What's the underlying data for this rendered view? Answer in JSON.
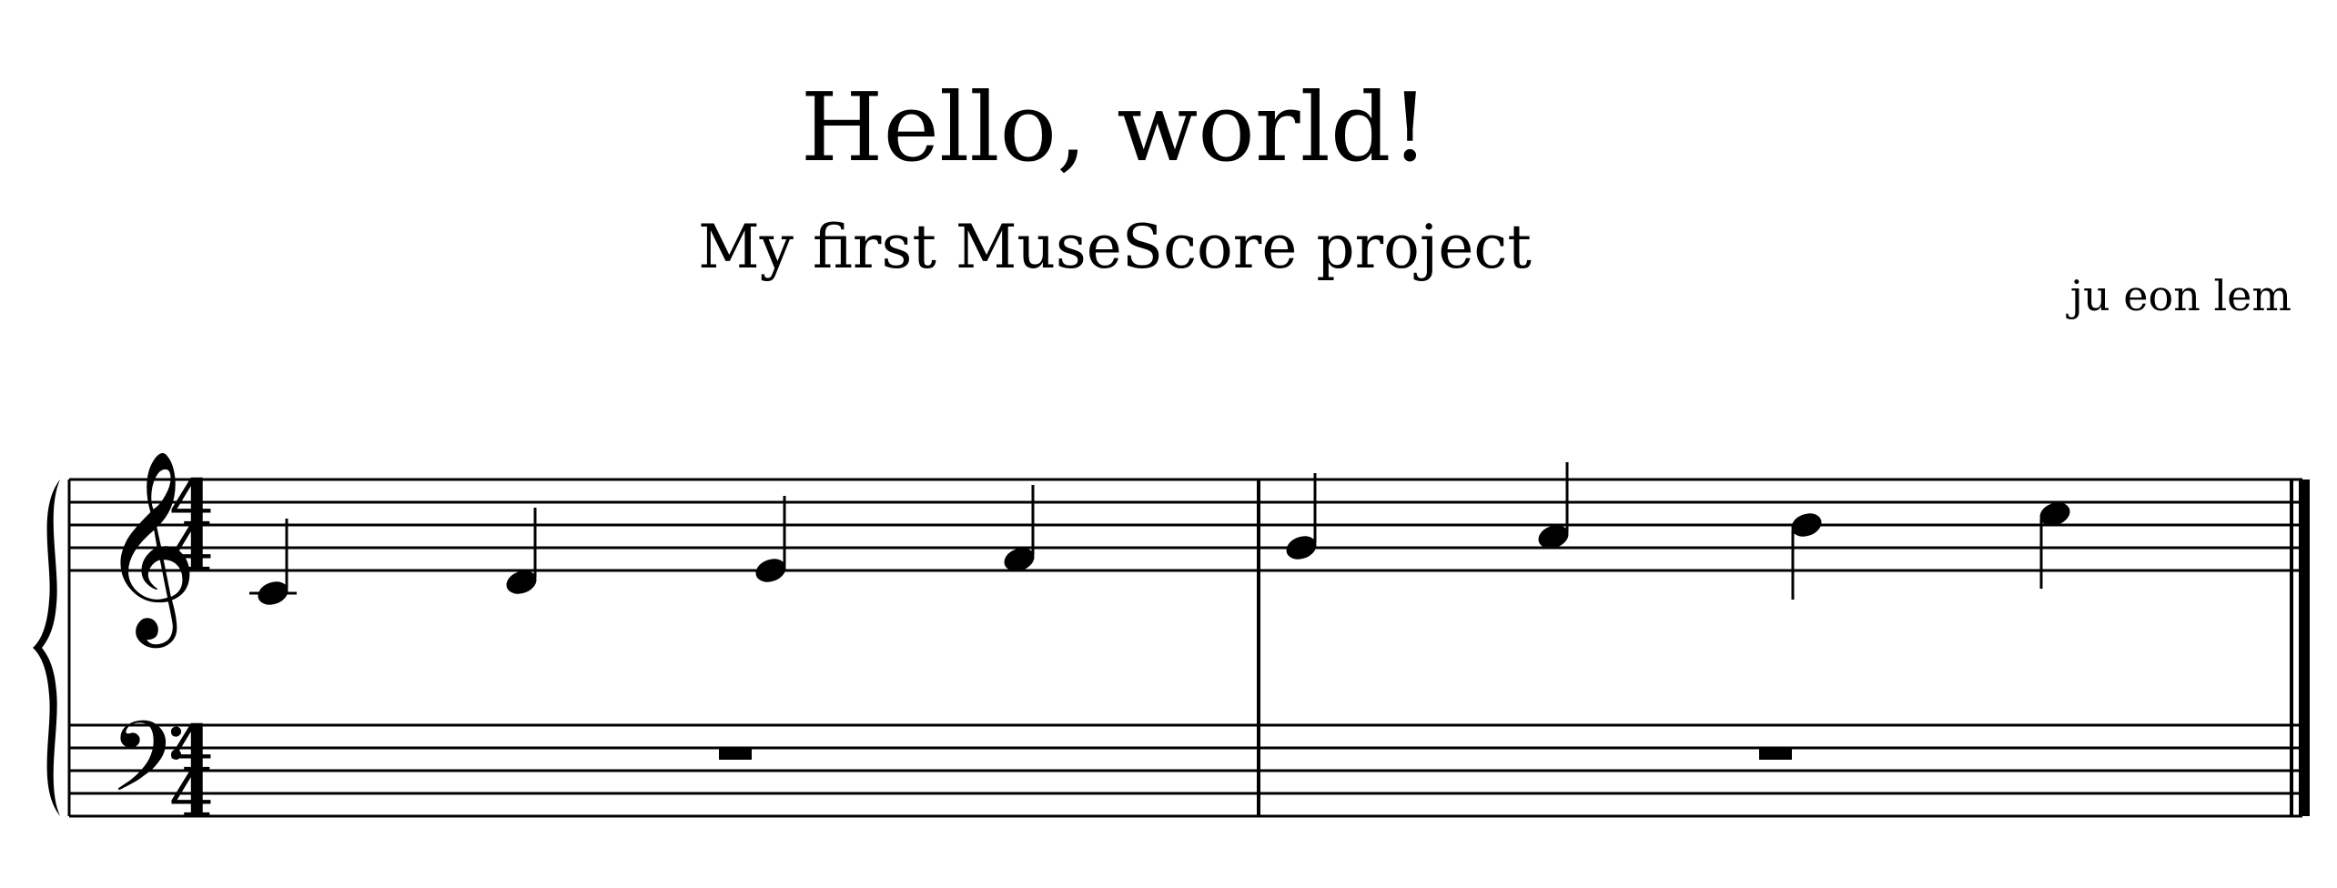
{
  "header": {
    "title": "Hello, world!",
    "subtitle": "My first MuseScore project",
    "composer": "ju eon lem"
  },
  "score": {
    "staves": [
      {
        "clef": "treble",
        "clef_glyph": "𝄞",
        "time_signature": {
          "top": "4",
          "bottom": "4"
        }
      },
      {
        "clef": "bass",
        "clef_glyph": "𝄢",
        "time_signature": {
          "top": "4",
          "bottom": "4"
        }
      }
    ],
    "measures": [
      {
        "treble": [
          {
            "pitch": "C4",
            "duration": "quarter"
          },
          {
            "pitch": "D4",
            "duration": "quarter"
          },
          {
            "pitch": "E4",
            "duration": "quarter"
          },
          {
            "pitch": "F4",
            "duration": "quarter"
          }
        ],
        "bass": [
          {
            "rest": "whole"
          }
        ]
      },
      {
        "treble": [
          {
            "pitch": "G4",
            "duration": "quarter"
          },
          {
            "pitch": "A4",
            "duration": "quarter"
          },
          {
            "pitch": "B4",
            "duration": "quarter"
          },
          {
            "pitch": "C5",
            "duration": "quarter"
          }
        ],
        "bass": [
          {
            "rest": "whole"
          }
        ]
      }
    ],
    "final_barline": "final"
  }
}
